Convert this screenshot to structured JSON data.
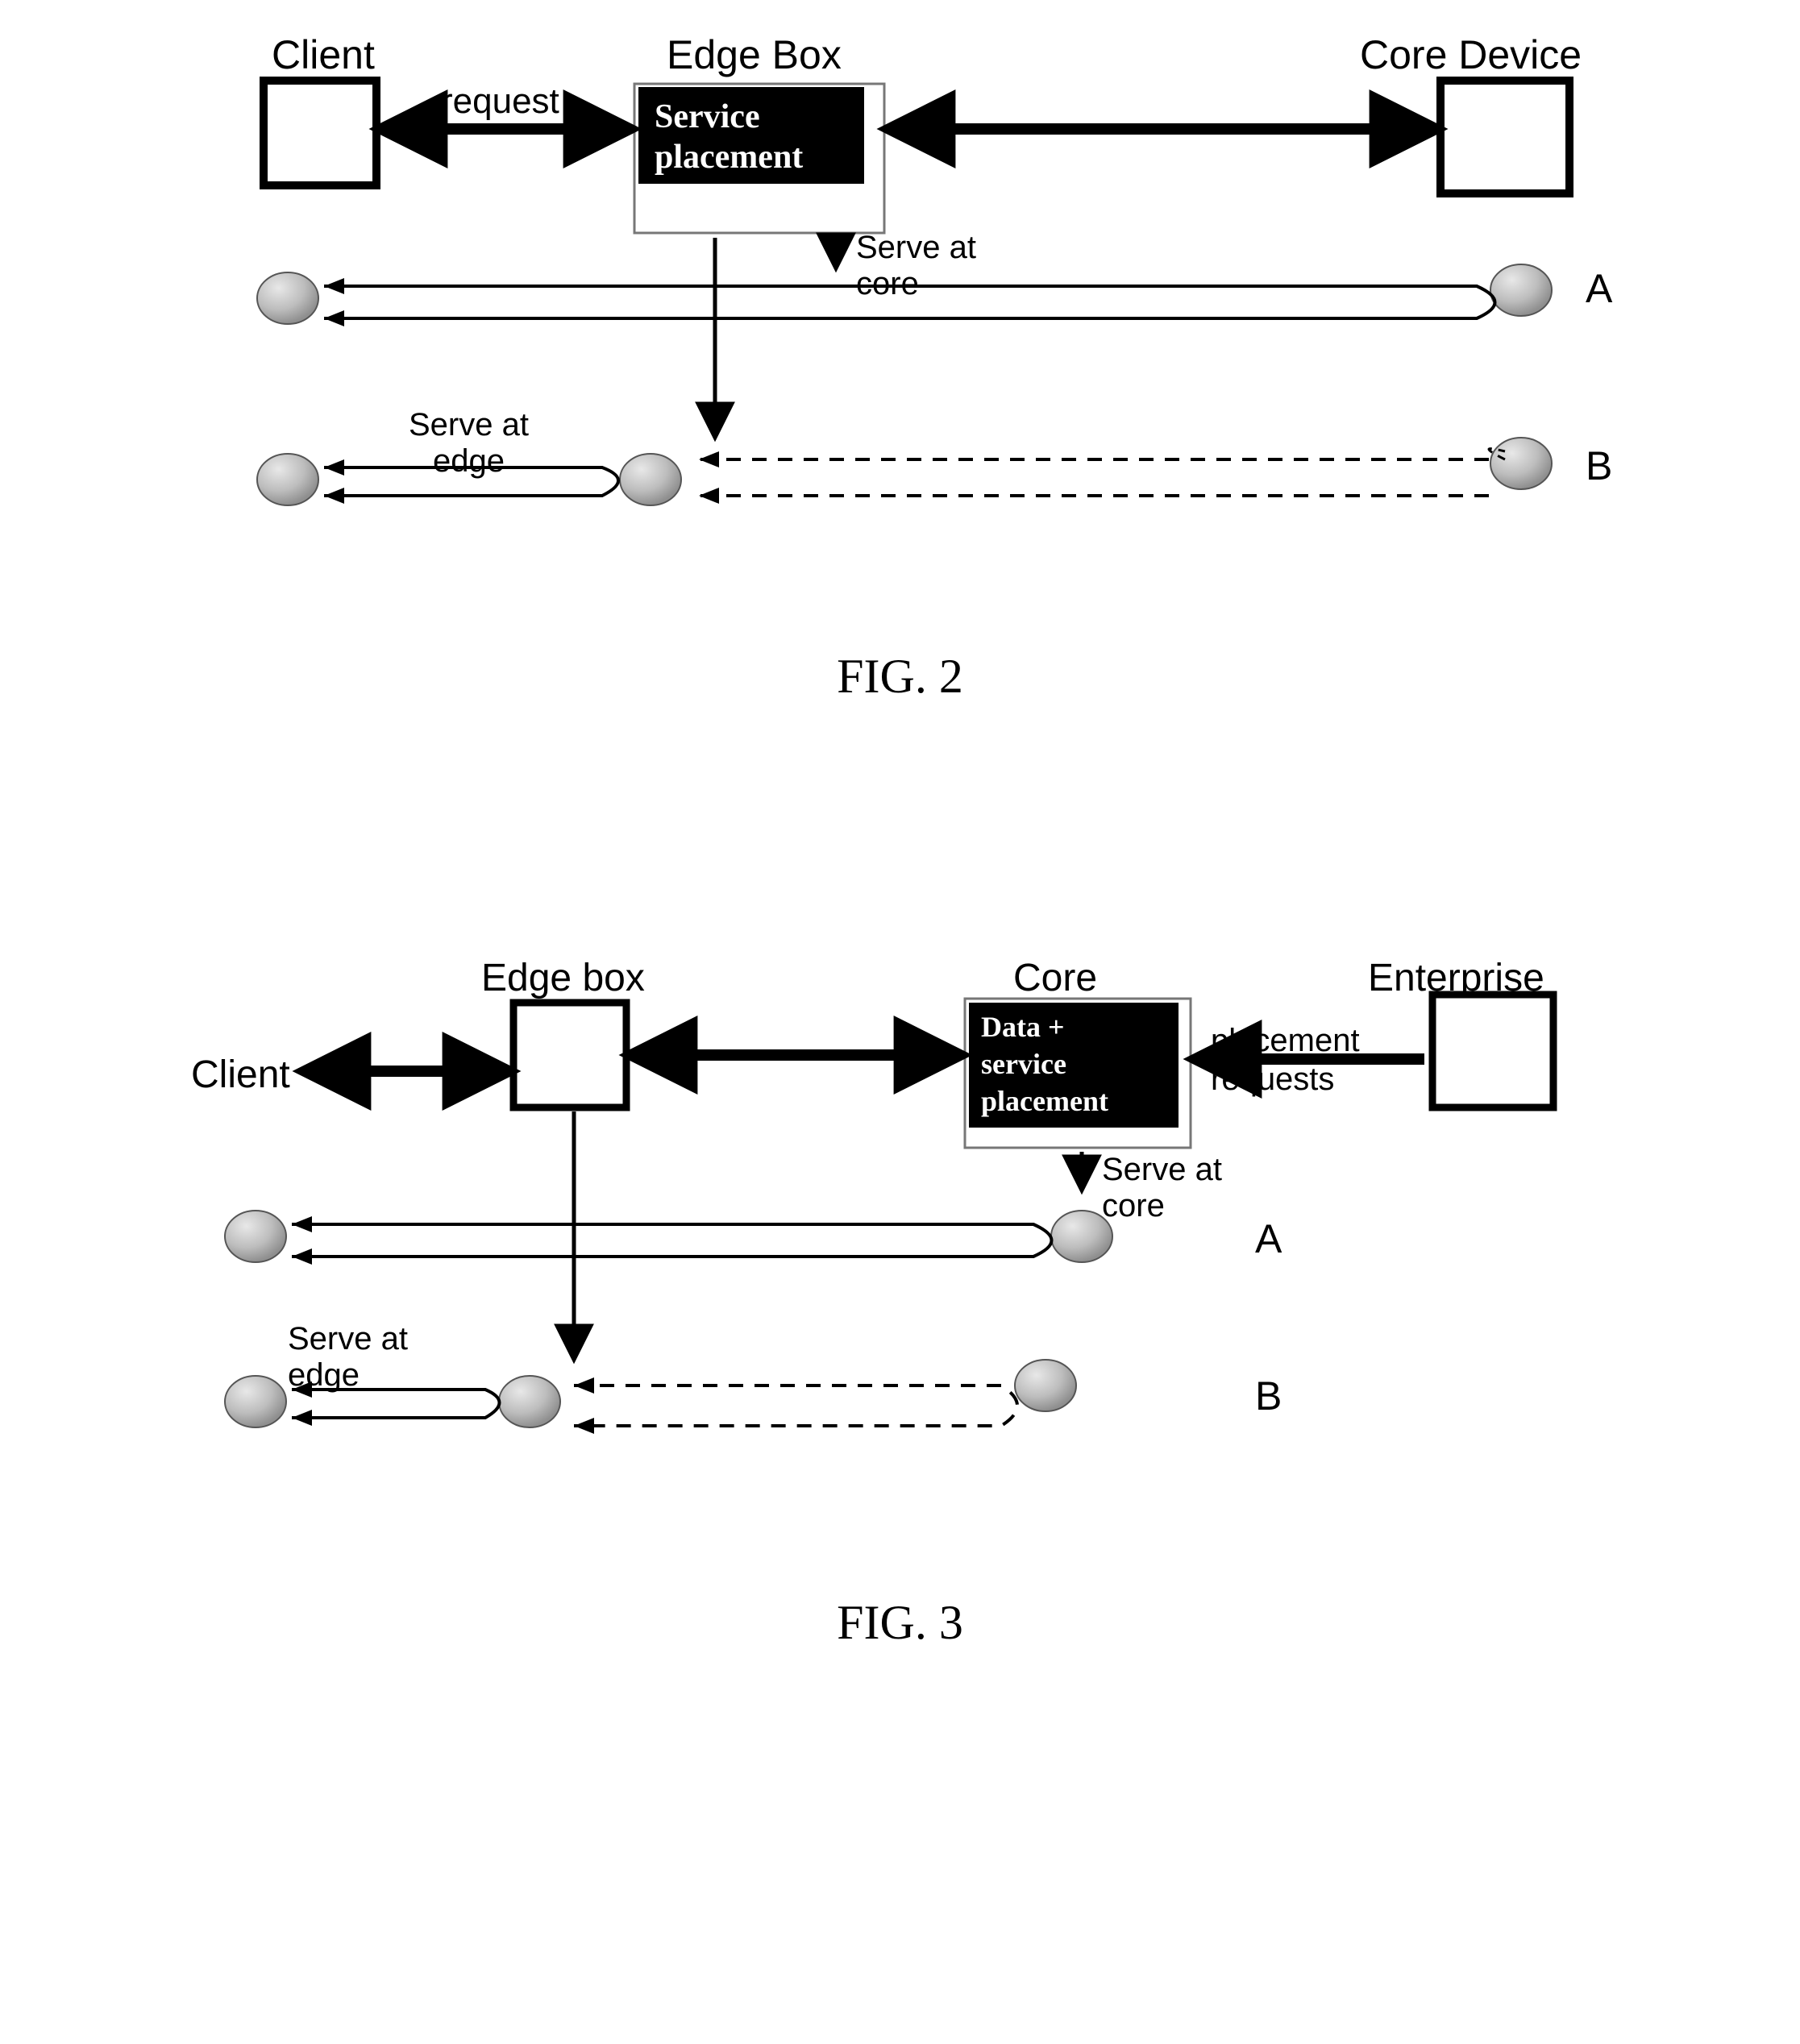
{
  "fig2": {
    "labels": {
      "client": "Client",
      "edgebox": "Edge Box",
      "coredevice": "Core Device",
      "request": "request",
      "serve_core": "Serve at\ncore",
      "serve_edge": "Serve at\nedge",
      "A": "A",
      "B": "B",
      "service_placement1": "Service",
      "service_placement2": "placement"
    },
    "caption": "FIG. 2"
  },
  "fig3": {
    "labels": {
      "client": "Client",
      "edgebox": "Edge box",
      "core": "Core",
      "enterprise": "Enterprise",
      "data_plus": "Data +",
      "service": "service",
      "placement": "placement",
      "placement_requests": "placement\nrequests",
      "serve_core": "Serve at\ncore",
      "serve_edge": "Serve at\nedge",
      "A": "A",
      "B": "B"
    },
    "caption": "FIG. 3"
  }
}
